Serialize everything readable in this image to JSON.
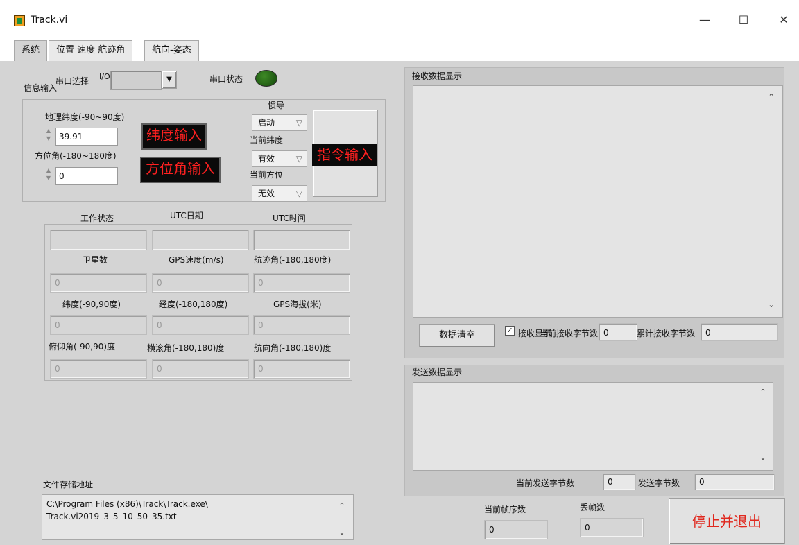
{
  "window": {
    "title": "Track.vi",
    "minimize": "—",
    "maximize": "☐",
    "close": "✕"
  },
  "tabs": [
    "系统",
    "位置 速度 航迹角",
    "航向-姿态"
  ],
  "info": {
    "group_label": "信息输入",
    "serial_select_label": "串口选择",
    "serial_select_prefix": "I/O",
    "serial_status_label": "串口状态",
    "lat_label": "地理纬度(-90~90度)",
    "lat_value": "39.91",
    "lat_button": "纬度输入",
    "az_label": "方位角(-180~180度)",
    "az_value": "0",
    "az_button": "方位角输入",
    "ins_label": "惯导",
    "ins_value": "启动",
    "cur_lat_label": "当前纬度",
    "cur_lat_value": "有效",
    "cur_az_label": "当前方位",
    "cur_az_value": "无效",
    "cmd_button": "指令输入"
  },
  "status": {
    "headers_row1": [
      "工作状态",
      "UTC日期",
      "UTC时间"
    ],
    "values_row1": [
      "",
      "",
      ""
    ],
    "headers_row2": [
      "卫星数",
      "GPS速度(m/s)",
      "航迹角(-180,180度)"
    ],
    "values_row2": [
      "0",
      "0",
      "0"
    ],
    "headers_row3": [
      "纬度(-90,90度)",
      "经度(-180,180度)",
      "GPS海拔(米)"
    ],
    "values_row3": [
      "0",
      "0",
      "0"
    ],
    "headers_row4": [
      "俯仰角(-90,90)度",
      "横滚角(-180,180)度",
      "航向角(-180,180)度"
    ],
    "values_row4": [
      "0",
      "0",
      "0"
    ]
  },
  "file": {
    "label": "文件存储地址",
    "line1": "C:\\Program Files (x86)\\Track\\Track.exe\\",
    "line2": "Track.vi2019_3_5_10_50_35.txt"
  },
  "receive": {
    "title": "接收数据显示",
    "clear_button": "数据清空",
    "checkbox_label": "接收显示",
    "cur_bytes_label": "当前接收字节数",
    "cur_bytes_value": "0",
    "total_bytes_label": "累计接收字节数",
    "total_bytes_value": "0"
  },
  "send": {
    "title": "发送数据显示",
    "cur_bytes_label": "当前发送字节数",
    "cur_bytes_value": "0",
    "total_bytes_label": "发送字节数",
    "total_bytes_value": "0"
  },
  "frames": {
    "cur_label": "当前帧序数",
    "cur_value": "0",
    "lost_label": "丢帧数",
    "lost_value": "0"
  },
  "stop_button": "停止并退出",
  "colors": {
    "led": "#1f5a12",
    "red_text": "#ff2020",
    "stop_text": "#e0281e"
  }
}
